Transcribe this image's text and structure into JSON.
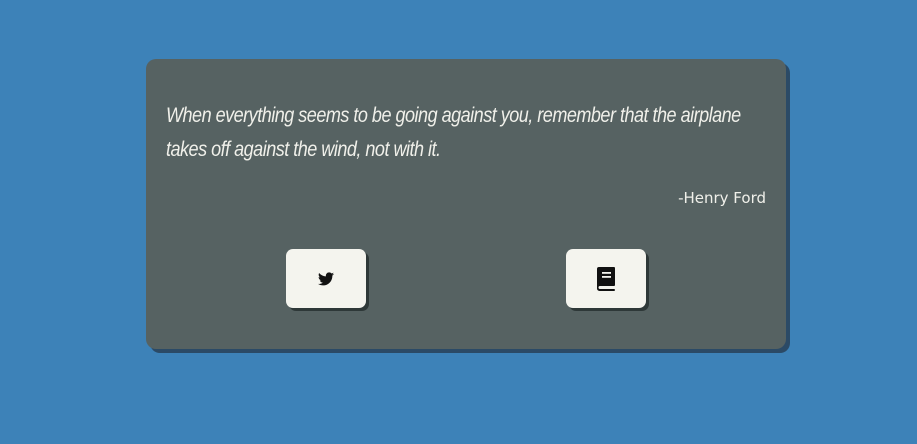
{
  "quote": {
    "text": "When everything seems to be going against you, remember that the airplane takes off against the wind, not with it.",
    "author": "-Henry Ford"
  },
  "buttons": {
    "tweet_icon": "twitter-icon",
    "new_quote_icon": "book-icon"
  },
  "colors": {
    "background": "#3d82b8",
    "card": "#566262",
    "button": "#f4f4ee",
    "text": "#f0f0ea"
  }
}
